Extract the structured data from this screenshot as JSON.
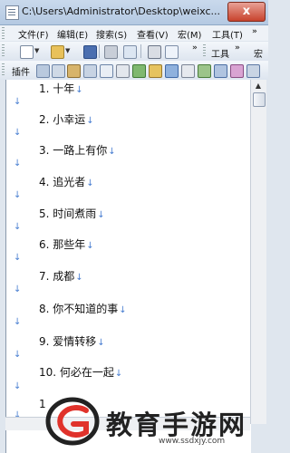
{
  "window": {
    "title": "C:\\Users\\Administrator\\Desktop\\weixc...",
    "close_label": "x"
  },
  "menu": [
    {
      "label": "文件(F)"
    },
    {
      "label": "编辑(E)"
    },
    {
      "label": "搜索(S)"
    },
    {
      "label": "查看(V)"
    },
    {
      "label": "宏(M)"
    },
    {
      "label": "工具(T)"
    }
  ],
  "toolbar2": {
    "tools_label": "工具",
    "macro_label": "宏"
  },
  "toolbar3": {
    "plugins_label": "插件"
  },
  "document": {
    "lines": [
      "1. 十年",
      "2. 小幸运",
      "3. 一路上有你",
      "4. 追光者",
      "5. 时间煮雨",
      "6. 那些年",
      "7. 成都",
      "8. 你不知道的事",
      "9. 爱情转移",
      "10. 何必在一起",
      "1"
    ],
    "return_mark": "↓",
    "para_mark": "↓"
  },
  "watermark": {
    "text": "教育手游网",
    "url": "www.ssdxjy.com"
  },
  "colors": {
    "accent": "#4a7fd1",
    "watermark_red": "#e0322b"
  }
}
